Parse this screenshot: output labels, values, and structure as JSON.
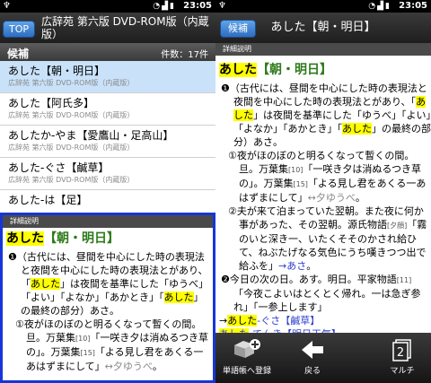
{
  "status_bar": {
    "time": "23:05"
  },
  "left": {
    "top_button": "TOP",
    "title": "広辞苑 第六版 DVD-ROM版（内蔵版）",
    "list_header": "候補",
    "count": "件数：17件",
    "items": [
      {
        "title": "あした【朝・明日】",
        "sub": "広辞苑 第六版 DVD-ROM版（内蔵版）"
      },
      {
        "title": "あした【阿氏多】",
        "sub": "広辞苑 第六版 DVD-ROM版（内蔵版）"
      },
      {
        "title": "あしたか‐やま【愛鷹山・足高山】",
        "sub": "広辞苑 第六版 DVD-ROM版（内蔵版）"
      },
      {
        "title": "あした‐ぐさ【鹹草】",
        "sub": "広辞苑 第六版 DVD-ROM版（内蔵版）"
      },
      {
        "title": "あした‐は【足】",
        "sub": ""
      }
    ],
    "detail_label": "詳細説明"
  },
  "entry": {
    "hw_kana": "あした",
    "hw_kanji": "【朝・明日】",
    "sense1_mark": "❶",
    "sense1": [
      "（古代には、昼間を中心にした時の表現法と夜間を中心にした時の表現法とがあり、「",
      "あした",
      "」は夜間を基準にした「ゆうべ」「よい」「よなか」「あかとき」「",
      "あした",
      "」の最終の部分）あさ。"
    ],
    "sub1_mark": "①",
    "sub1": [
      "夜がほのぼのと明るくなって暫くの間。旦。万葉集",
      "[10]",
      "「一咲き夕は消ぬるつき草の」。万葉集",
      "[15]",
      "「よる見し君をあくる一あはずまにして」",
      "↔夕ゆうべ",
      "。"
    ],
    "sub2_mark": "②",
    "sub2": [
      "夫が来て泊まっていた翌朝。また夜に何か事があった、その翌朝。源氏物語",
      "[夕顔]",
      "「霧のいと深き一、いたくそそのかされ給ひて、ねぶたげなる気色にうち嘆きつつ出で給ふを」",
      "→あさ",
      "。"
    ],
    "sense2_mark": "❷",
    "sense2": [
      "今日の次の日。あす。明日。平家物語",
      "[11]",
      "「今夜こよいはとくとく帰れ。一は急ぎ参れ」「一参上します」"
    ],
    "ref": [
      "→",
      "あした",
      "‐ぐさ【鹹草】"
    ],
    "ref_next": "‐てんき【明日天気】"
  },
  "right": {
    "back_button": "候補",
    "title": "あした【朝・明日】",
    "detail_label": "詳細説明",
    "toolbar": [
      {
        "label": "単語帳へ登録",
        "icon": "add-to-wordbook-icon"
      },
      {
        "label": "戻る",
        "icon": "back-arrow-icon"
      },
      {
        "label": "マルチ",
        "icon": "multi-window-icon",
        "badge": "2"
      }
    ]
  }
}
